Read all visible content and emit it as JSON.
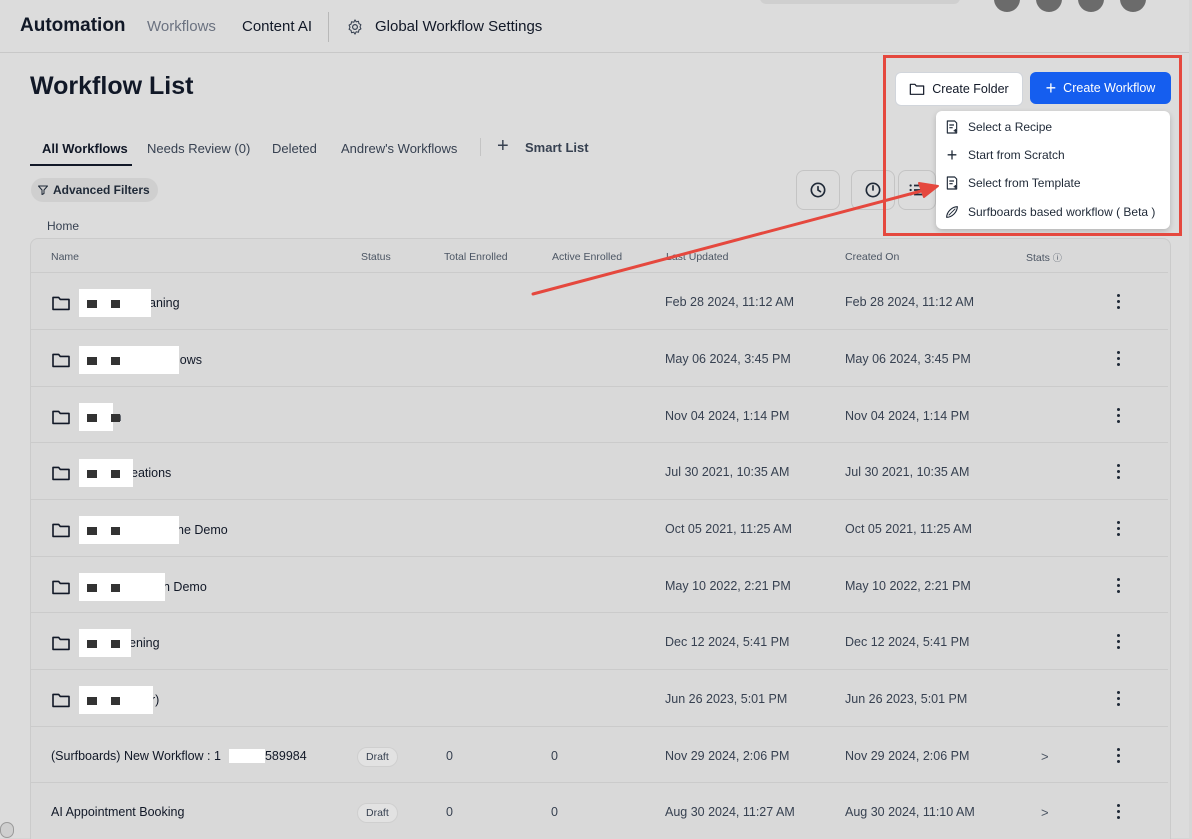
{
  "nav": {
    "brand": "Automation",
    "tabs": [
      "Workflows",
      "Content AI"
    ],
    "settings_label": "Global Workflow Settings"
  },
  "page": {
    "title": "Workflow List",
    "create_folder": "Create Folder",
    "create_workflow": "Create Workflow"
  },
  "tabs": {
    "all": "All Workflows",
    "review": "Needs Review (0)",
    "deleted": "Deleted",
    "andrew": "Andrew's Workflows",
    "smart": "Smart List"
  },
  "filters": {
    "advanced": "Advanced Filters"
  },
  "breadcrumb": {
    "home": "Home"
  },
  "dropdown": {
    "items": [
      "Select a Recipe",
      "Start from Scratch",
      "Select from Template",
      "Surfboards based workflow ( Beta )"
    ]
  },
  "table": {
    "headers": {
      "name": "Name",
      "status": "Status",
      "total": "Total Enrolled",
      "active": "Active Enrolled",
      "updated": "Last Updated",
      "created": "Created On",
      "stats": "Stats"
    },
    "rows": [
      {
        "name": "aning",
        "updated": "Feb 28 2024, 11:12 AM",
        "created": "Feb 28 2024, 11:12 AM"
      },
      {
        "name": "lows",
        "updated": "May 06 2024, 3:45 PM",
        "created": "May 06 2024, 3:45 PM"
      },
      {
        "name": "m",
        "updated": "Nov 04 2024, 1:14 PM",
        "created": "Nov 04 2024, 1:14 PM"
      },
      {
        "name": "eations",
        "updated": "Jul 30 2021, 10:35 AM",
        "created": "Jul 30 2021, 10:35 AM"
      },
      {
        "name": "ne Demo",
        "updated": "Oct 05 2021, 11:25 AM",
        "created": "Oct 05 2021, 11:25 AM"
      },
      {
        "name": "n Demo",
        "updated": "May 10 2022, 2:21 PM",
        "created": "May 10 2022, 2:21 PM"
      },
      {
        "name": "ening",
        "updated": "Dec 12 2024, 5:41 PM",
        "created": "Dec 12 2024, 5:41 PM"
      },
      {
        "name": "r)",
        "updated": "Jun 26 2023, 5:01 PM",
        "created": "Jun 26 2023, 5:01 PM"
      },
      {
        "name": "(Surfboards) New Workflow : 1",
        "name_tail": "589984",
        "status": "Draft",
        "total": "0",
        "active": "0",
        "updated": "Nov 29 2024, 2:06 PM",
        "created": "Nov 29 2024, 2:06 PM",
        "stats": ">"
      },
      {
        "name": "AI Appointment Booking",
        "status": "Draft",
        "total": "0",
        "active": "0",
        "updated": "Aug 30 2024, 11:27 AM",
        "created": "Aug 30 2024, 11:10 AM",
        "stats": ">"
      }
    ]
  },
  "colors": {
    "primary": "#155eef",
    "annotation": "#e5483e",
    "dim_bg": "#dcdcdc"
  }
}
